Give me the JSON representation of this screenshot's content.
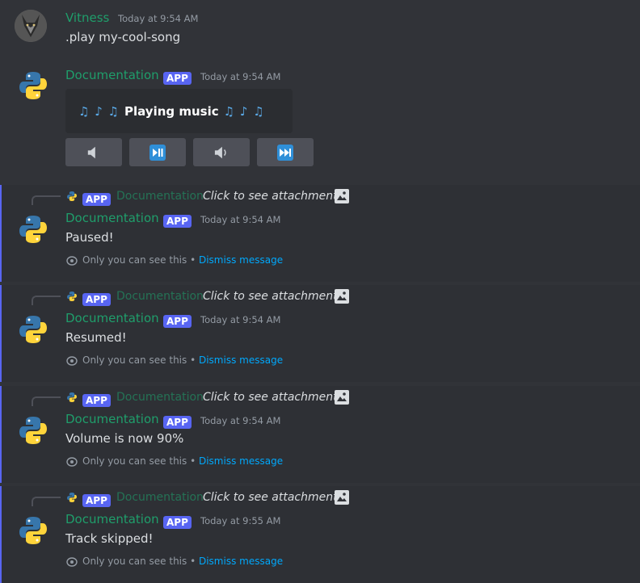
{
  "messages": [
    {
      "author": "Vitness",
      "timestamp": "Today at 9:54 AM",
      "content": ".play my-cool-song"
    },
    {
      "author": "Documentation",
      "badge": "APP",
      "timestamp": "Today at 9:54 AM",
      "embed": {
        "notes_left": "♫ ♪ ♫",
        "text": "Playing music",
        "notes_right": "♫ ♪ ♫"
      },
      "buttons": [
        {
          "name": "volume-down",
          "icon": "speaker-low-icon",
          "glyph": "🔈"
        },
        {
          "name": "pause-resume",
          "icon": "play-pause-icon",
          "glyph": "⏯"
        },
        {
          "name": "volume-up",
          "icon": "speaker-medium-icon",
          "glyph": "🔉"
        },
        {
          "name": "skip",
          "icon": "next-track-icon",
          "glyph": "⏭"
        }
      ]
    }
  ],
  "ephemeral": [
    {
      "reply_badge": "APP",
      "reply_author": "Documentation",
      "reply_text": "Click to see attachment",
      "author": "Documentation",
      "badge": "APP",
      "timestamp": "Today at 9:54 AM",
      "content": "Paused!",
      "only_text": "Only you can see this •",
      "dismiss": "Dismiss message"
    },
    {
      "reply_badge": "APP",
      "reply_author": "Documentation",
      "reply_text": "Click to see attachment",
      "author": "Documentation",
      "badge": "APP",
      "timestamp": "Today at 9:54 AM",
      "content": "Resumed!",
      "only_text": "Only you can see this •",
      "dismiss": "Dismiss message"
    },
    {
      "reply_badge": "APP",
      "reply_author": "Documentation",
      "reply_text": "Click to see attachment",
      "author": "Documentation",
      "badge": "APP",
      "timestamp": "Today at 9:54 AM",
      "content": "Volume is now 90%",
      "only_text": "Only you can see this •",
      "dismiss": "Dismiss message"
    },
    {
      "reply_badge": "APP",
      "reply_author": "Documentation",
      "reply_text": "Click to see attachment",
      "author": "Documentation",
      "badge": "APP",
      "timestamp": "Today at 9:55 AM",
      "content": "Track skipped!",
      "only_text": "Only you can see this •",
      "dismiss": "Dismiss message"
    }
  ],
  "colors": {
    "background": "#313338",
    "username": "#1f9e6b",
    "app_badge": "#5865f2",
    "link": "#00a8fc",
    "button": "#4e5058",
    "embed": "#2b2d31"
  }
}
